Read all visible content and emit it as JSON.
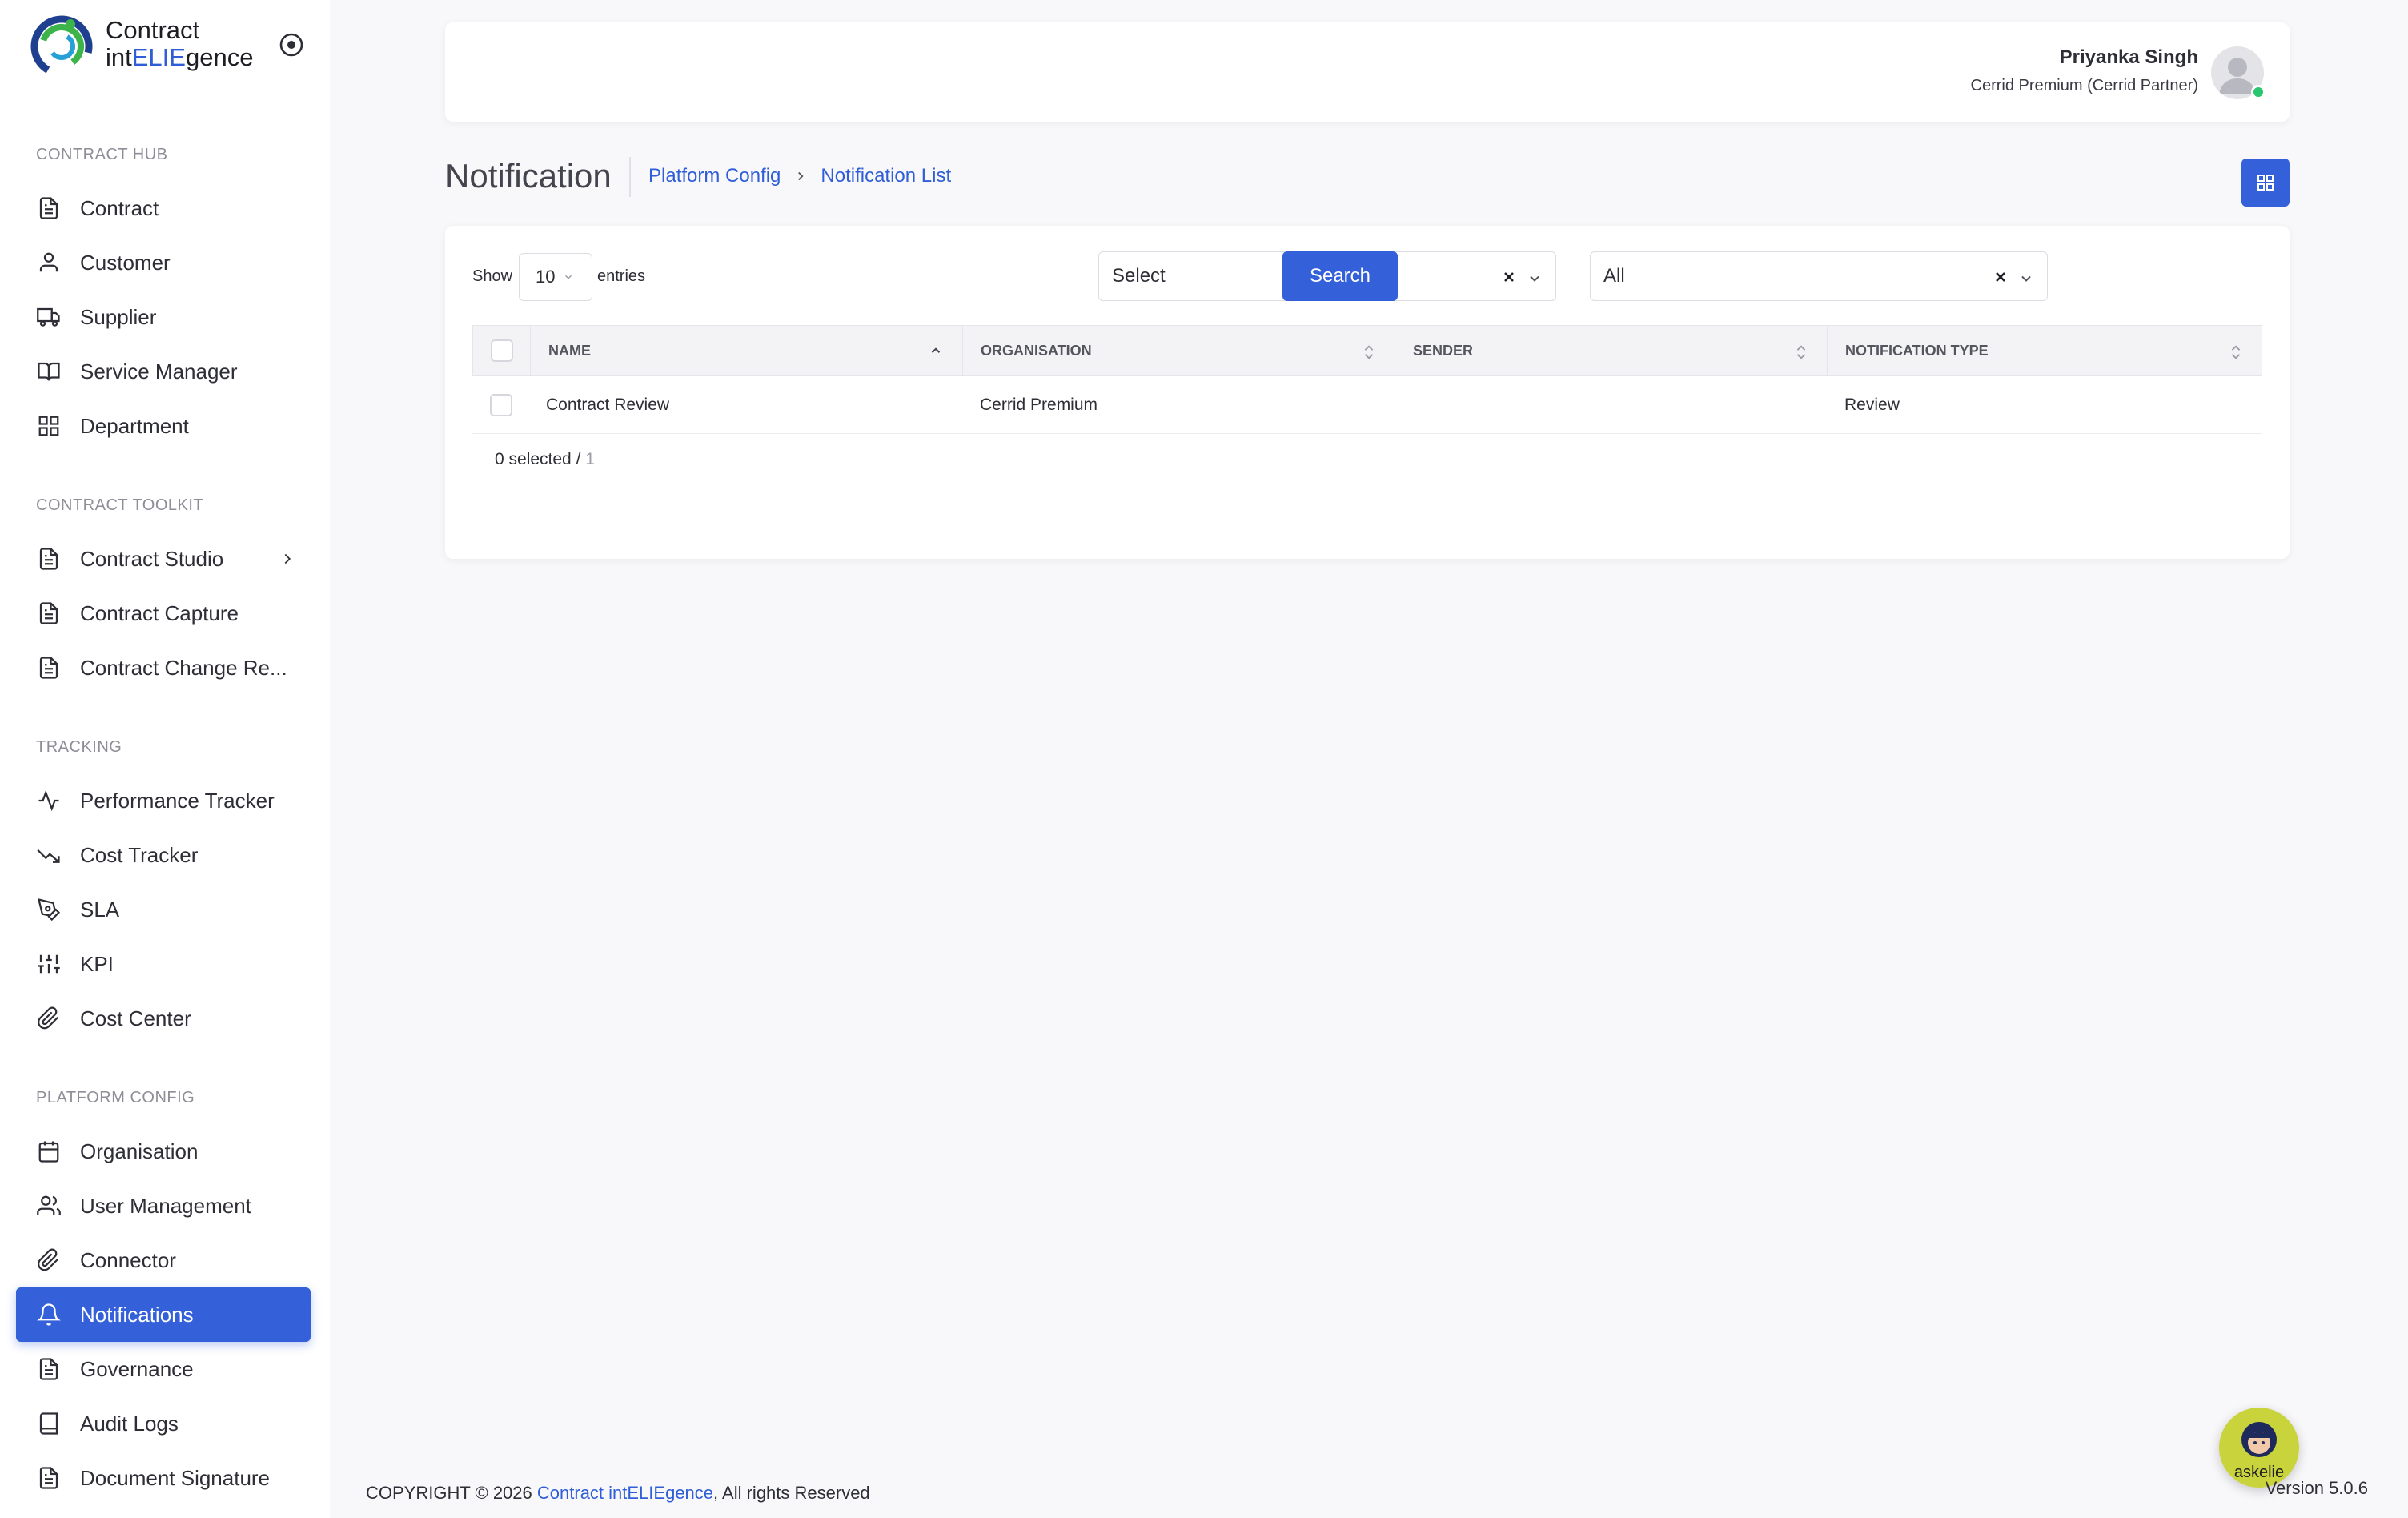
{
  "brand": {
    "logo_line1": "Contract",
    "logo_line2_a": "int",
    "logo_line2_b": "ELIE",
    "logo_line2_c": "gence"
  },
  "sidebar": {
    "sections": [
      {
        "title": "CONTRACT HUB",
        "items": [
          {
            "label": "Contract",
            "icon": "file-text-icon"
          },
          {
            "label": "Customer",
            "icon": "user-icon"
          },
          {
            "label": "Supplier",
            "icon": "truck-icon"
          },
          {
            "label": "Service Manager",
            "icon": "book-open-icon"
          },
          {
            "label": "Department",
            "icon": "grid-icon"
          }
        ]
      },
      {
        "title": "CONTRACT TOOLKIT",
        "items": [
          {
            "label": "Contract Studio",
            "icon": "file-text-icon"
          },
          {
            "label": "Contract Capture",
            "icon": "file-text-icon"
          },
          {
            "label": "Contract Change Re...",
            "icon": "file-text-icon"
          }
        ]
      },
      {
        "title": "TRACKING",
        "items": [
          {
            "label": "Performance Tracker",
            "icon": "activity-icon"
          },
          {
            "label": "Cost Tracker",
            "icon": "trending-down-icon"
          },
          {
            "label": "SLA",
            "icon": "pen-tool-icon"
          },
          {
            "label": "KPI",
            "icon": "sliders-icon"
          },
          {
            "label": "Cost Center",
            "icon": "paperclip-icon"
          }
        ]
      },
      {
        "title": "PLATFORM CONFIG",
        "items": [
          {
            "label": "Organisation",
            "icon": "calendar-icon"
          },
          {
            "label": "User Management",
            "icon": "users-icon"
          },
          {
            "label": "Connector",
            "icon": "paperclip-icon"
          },
          {
            "label": "Notifications",
            "icon": "bell-icon"
          },
          {
            "label": "Governance",
            "icon": "file-text-icon"
          },
          {
            "label": "Audit Logs",
            "icon": "book-icon"
          },
          {
            "label": "Document Signature",
            "icon": "file-text-icon"
          }
        ]
      }
    ],
    "active_item": "Notifications"
  },
  "header": {
    "user_name": "Priyanka Singh",
    "user_org": "Cerrid Premium (Cerrid Partner)",
    "status": "online"
  },
  "page": {
    "title": "Notification",
    "breadcrumb": [
      "Platform Config",
      "Notification List"
    ]
  },
  "controls": {
    "show_label": "Show",
    "entries_value": "10",
    "entries_label": "entries",
    "filter1_value": "Select",
    "filter2_value": "All",
    "search_label": "Search"
  },
  "table": {
    "columns": [
      "NAME",
      "ORGANISATION",
      "SENDER",
      "NOTIFICATION TYPE"
    ],
    "rows": [
      {
        "name": "Contract Review",
        "organisation": "Cerrid Premium",
        "sender": "",
        "type": "Review"
      }
    ],
    "selected_text": "0 selected / ",
    "total": "1"
  },
  "footer": {
    "copyright_prefix": "COPYRIGHT © 2026 ",
    "brand_link": "Contract intELIEgence",
    "copyright_suffix": ", All rights Reserved",
    "version": "Version 5.0.6",
    "assistant_label": "askelie"
  },
  "colors": {
    "accent": "#3461d9",
    "link": "#2f5ed6",
    "online": "#28c76f",
    "assistant_bg": "#c9d33b"
  }
}
